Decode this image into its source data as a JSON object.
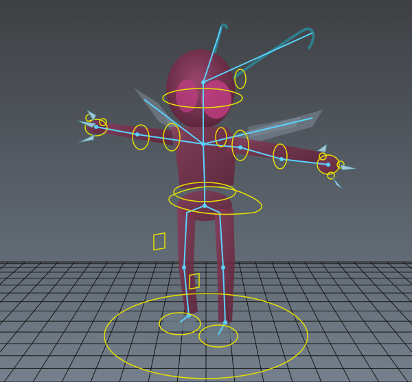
{
  "viewport": {
    "background_top": "#3e4043",
    "background_bottom": "#74808c",
    "grid_color": "#151515",
    "grid_axis_color": "#000000",
    "rig_control_color": "#e5e000",
    "joint_color": "#5ad2ff",
    "mesh_color": "#7a2a4a",
    "mesh_highlight_color": "#c23d83",
    "antenna_color": "#2f7e8c"
  },
  "scene": {
    "character": "ant-character-rig",
    "rig_controls_visible": true,
    "skeleton_visible": true,
    "grid_visible": true
  }
}
